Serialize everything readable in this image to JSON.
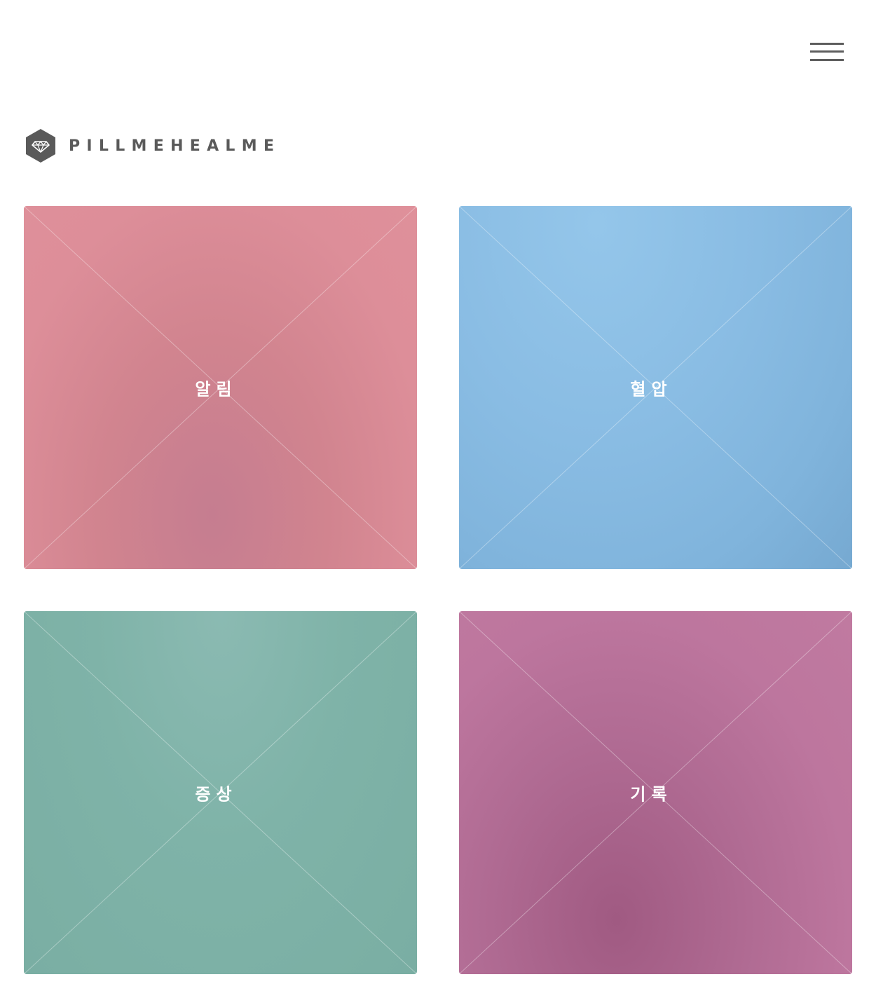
{
  "header": {
    "menu_icon": "hamburger-menu-icon"
  },
  "brand": {
    "name": "PILLMEHEALME",
    "icon": "hexagon-diamond-logo-icon",
    "color": "#5a5a5a"
  },
  "tiles": [
    {
      "label": "알림",
      "color": "#d6878f"
    },
    {
      "label": "혈압",
      "color": "#88bbe3"
    },
    {
      "label": "증상",
      "color": "#7fb3a8"
    },
    {
      "label": "기록",
      "color": "#b46c96"
    }
  ]
}
